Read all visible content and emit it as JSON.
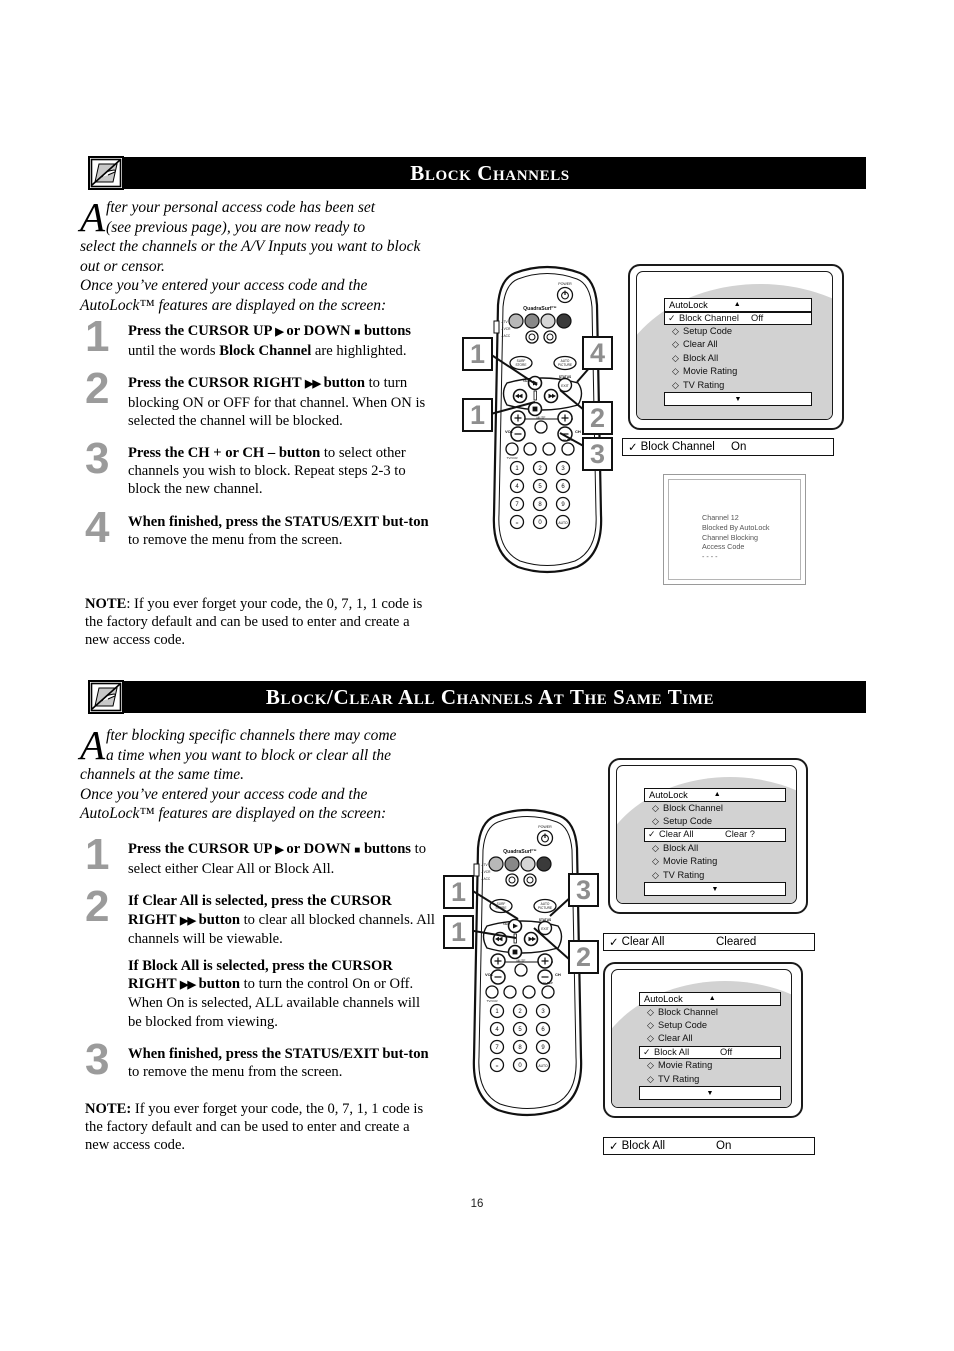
{
  "page": {
    "number": "16"
  },
  "sections": [
    {
      "id": "block-channels",
      "title": "Block Channels",
      "icon": "blocked-hand-screen-icon",
      "intro": {
        "dropcap": "A",
        "line1": "fter your personal access code has been set",
        "line2": "(see previous page), you are now ready to",
        "rest": "select the channels or the A/V Inputs you want to block out or censor.",
        "rest2": "Once you’ve entered your access code and the AutoLock™ features are displayed on the screen:"
      },
      "steps": [
        {
          "num": "1",
          "parts": [
            {
              "t": "Press the CURSOR UP ",
              "b": true
            },
            {
              "t": "▶",
              "b": true,
              "glyph": "right"
            },
            {
              "t": " or DOWN ",
              "b": true
            },
            {
              "t": "■",
              "b": true,
              "glyph": "sq"
            },
            {
              "t": " buttons",
              "b": true
            },
            {
              "t": " until the words ",
              "b": false
            },
            {
              "t": "Block Channel",
              "b": true
            },
            {
              "t": " are highlighted.",
              "b": false
            }
          ]
        },
        {
          "num": "2",
          "parts": [
            {
              "t": "Press the CURSOR RIGHT ",
              "b": true
            },
            {
              "t": "▶▶",
              "b": true,
              "glyph": "right"
            },
            {
              "t": " button",
              "b": true
            },
            {
              "t": " to turn blocking ON or OFF for that channel. When ON is selected the channel will be blocked.",
              "b": false
            }
          ]
        },
        {
          "num": "3",
          "parts": [
            {
              "t": "Press the CH + or CH – button",
              "b": true
            },
            {
              "t": " to select other channels you wish to block. Repeat steps 2-3 to block the new channel.",
              "b": false
            }
          ]
        },
        {
          "num": "4",
          "parts": [
            {
              "t": "When finished, press the STATUS/EXIT but-ton",
              "b": true
            },
            {
              "t": " to remove the menu from the screen.",
              "b": false
            }
          ]
        }
      ],
      "note": {
        "label": "NOTE",
        "text": ": If you ever forget your code, the 0, 7, 1, 1 code is the factory default and can be used to enter and create a new access code."
      },
      "callouts": [
        "1",
        "4",
        "1",
        "2",
        "3"
      ],
      "osd": {
        "title": "AutoLock",
        "title_arrow": "▲",
        "foot_arrow": "▼",
        "items": [
          {
            "mark": "✓",
            "label": "Block Channel",
            "value": "Off",
            "highlight": true
          },
          {
            "mark": "◇",
            "label": "Setup Code",
            "value": "",
            "highlight": false
          },
          {
            "mark": "◇",
            "label": "Clear All",
            "value": "",
            "highlight": false
          },
          {
            "mark": "◇",
            "label": "Block All",
            "value": "",
            "highlight": false
          },
          {
            "mark": "◇",
            "label": "Movie Rating",
            "value": "",
            "highlight": false
          },
          {
            "mark": "◇",
            "label": "TV Rating",
            "value": "",
            "highlight": false
          }
        ]
      },
      "status": {
        "mark": "✓",
        "label": "Block Channel",
        "value": "On"
      },
      "info_screen": {
        "lines": [
          "Channel 12",
          "Blocked By AutoLock",
          "Channel Blocking",
          "Access Code",
          "- - - -"
        ]
      }
    },
    {
      "id": "block-clear-all",
      "title": "Block/Clear All Channels At The Same Time",
      "icon": "blocked-hand-screen-icon",
      "intro": {
        "dropcap": "A",
        "line1": "fter blocking specific channels there may come",
        "line2": "a time when you want to block or clear all the",
        "rest": "channels at the same time.",
        "rest2": "Once you’ve entered your access code and the AutoLock™ features are displayed on the screen:"
      },
      "steps": [
        {
          "num": "1",
          "parts": [
            {
              "t": "Press the CURSOR UP ",
              "b": true
            },
            {
              "t": "▶",
              "b": true,
              "glyph": "right"
            },
            {
              "t": " or DOWN ",
              "b": true
            },
            {
              "t": "■",
              "b": true,
              "glyph": "sq"
            },
            {
              "t": " buttons",
              "b": true
            },
            {
              "t": " to select either Clear All or Block All.",
              "b": false
            }
          ]
        },
        {
          "num": "2",
          "parts": [
            {
              "t": "If Clear All is selected, press the CURSOR RIGHT ",
              "b": true
            },
            {
              "t": "▶▶",
              "b": true,
              "glyph": "right"
            },
            {
              "t": " button",
              "b": true
            },
            {
              "t": " to clear all blocked channels.  All channels will be viewable.",
              "b": false
            },
            {
              "t": "BREAK",
              "b": false
            },
            {
              "t": "If Block All is selected, press the CURSOR RIGHT ",
              "b": true
            },
            {
              "t": "▶▶",
              "b": true,
              "glyph": "right"
            },
            {
              "t": " button",
              "b": true
            },
            {
              "t": " to turn the control On or Off. When On is selected, ALL available channels will be blocked from viewing.",
              "b": false
            }
          ]
        },
        {
          "num": "3",
          "parts": [
            {
              "t": "When finished, press the STATUS/EXIT but-ton",
              "b": true
            },
            {
              "t": " to remove the menu from the screen.",
              "b": false
            }
          ]
        }
      ],
      "note": {
        "label": "NOTE:",
        "text": " If you ever forget your code, the 0, 7, 1, 1 code is the factory default and can be used to enter and create a new access code."
      },
      "callouts": [
        "1",
        "3",
        "1",
        "2"
      ],
      "osd_top": {
        "title": "AutoLock",
        "title_arrow": "▲",
        "foot_arrow": "▼",
        "items": [
          {
            "mark": "◇",
            "label": "Block Channel",
            "value": "",
            "highlight": false
          },
          {
            "mark": "◇",
            "label": "Setup Code",
            "value": "",
            "highlight": false
          },
          {
            "mark": "✓",
            "label": "Clear All",
            "value": "Clear ?",
            "highlight": true
          },
          {
            "mark": "◇",
            "label": "Block All",
            "value": "",
            "highlight": false
          },
          {
            "mark": "◇",
            "label": "Movie Rating",
            "value": "",
            "highlight": false
          },
          {
            "mark": "◇",
            "label": "TV Rating",
            "value": "",
            "highlight": false
          }
        ]
      },
      "status_top": {
        "mark": "✓",
        "label": "Clear All",
        "value": "Cleared"
      },
      "osd_bottom": {
        "title": "AutoLock",
        "title_arrow": "▲",
        "foot_arrow": "▼",
        "items": [
          {
            "mark": "◇",
            "label": "Block Channel",
            "value": "",
            "highlight": false
          },
          {
            "mark": "◇",
            "label": "Setup Code",
            "value": "",
            "highlight": false
          },
          {
            "mark": "◇",
            "label": "Clear All",
            "value": "",
            "highlight": false
          },
          {
            "mark": "✓",
            "label": "Block All",
            "value": "Off",
            "highlight": true
          },
          {
            "mark": "◇",
            "label": "Movie Rating",
            "value": "",
            "highlight": false
          },
          {
            "mark": "◇",
            "label": "TV Rating",
            "value": "",
            "highlight": false
          }
        ]
      },
      "status_bottom": {
        "mark": "✓",
        "label": "Block All",
        "value": "On"
      }
    }
  ],
  "remote": {
    "brand": "QuadraSurf™",
    "power_label": "POWER",
    "mode_labels": [
      "TV",
      "VCR",
      "ACC"
    ],
    "left_button": "SURF\nSTORE",
    "right_button": "AUTO\nPICTURE",
    "status_exit_top": "STATUS",
    "status_exit": "EXIT",
    "vol_label": "VOL",
    "ch_label": "CH",
    "mute_label": "MUTE",
    "menu_label": "MENU",
    "tvvcr_label": "TV/VCR",
    "sleep_label": "SLEEP",
    "keypad": [
      "1",
      "2",
      "3",
      "4",
      "5",
      "6",
      "7",
      "8",
      "9",
      "•",
      "0",
      "AUTO"
    ]
  },
  "colors": {
    "header_bg": "#000000",
    "header_fg": "#ffffff",
    "step_number": "#9b9b9b",
    "tv_shade": "#d2d2d2",
    "callout_fg": "#8e8e8e"
  }
}
